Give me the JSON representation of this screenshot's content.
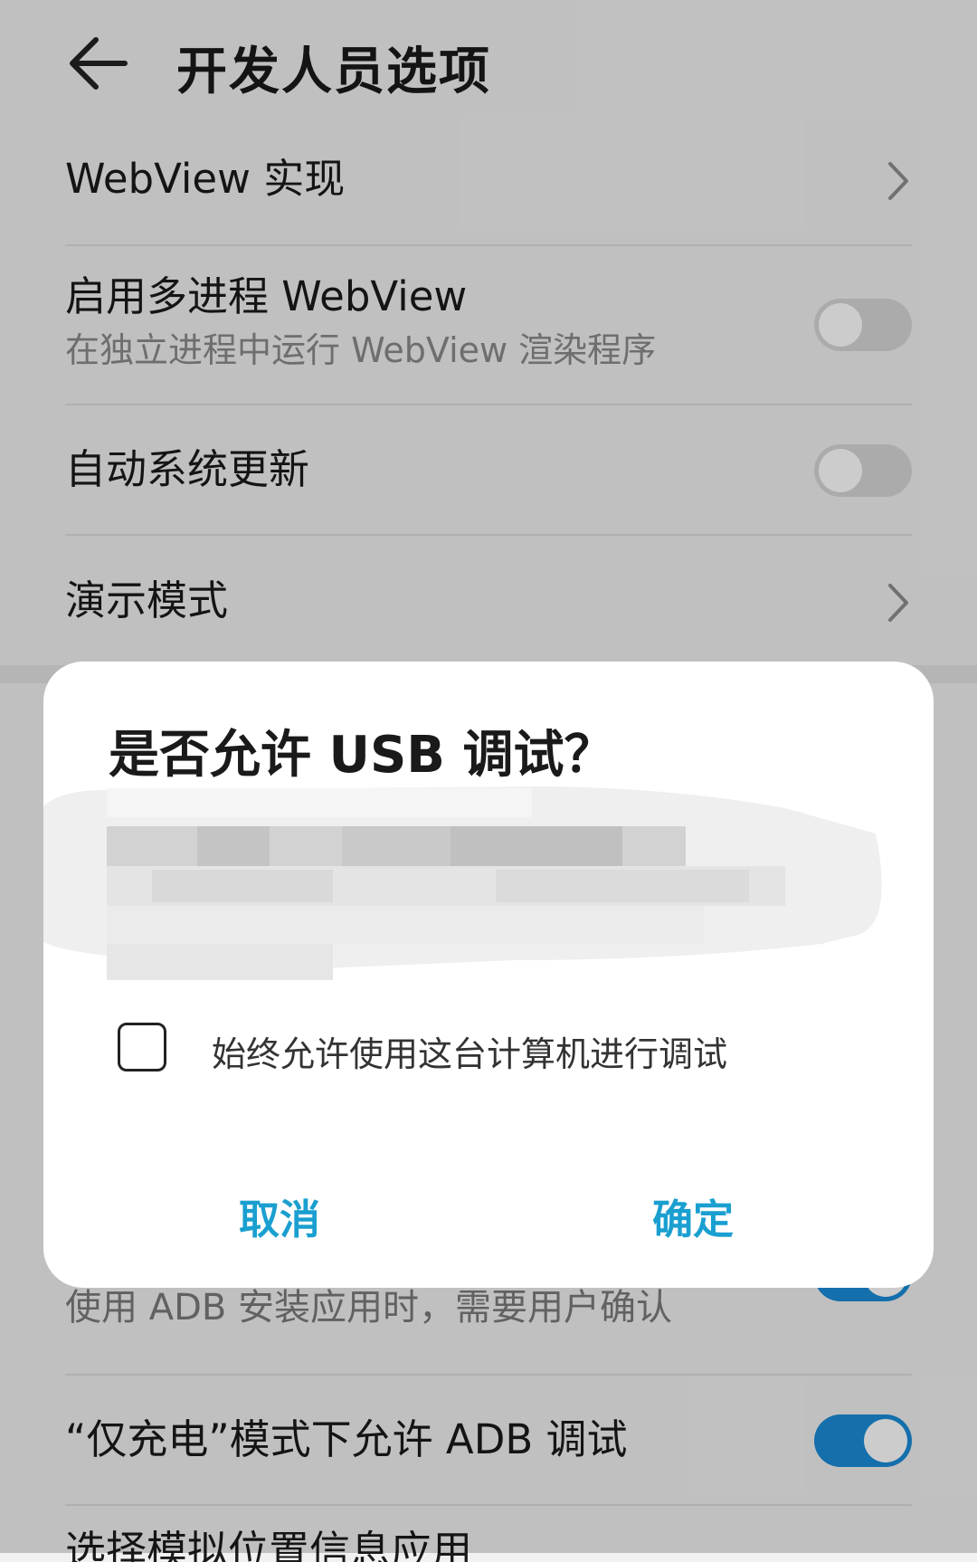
{
  "header": {
    "title": "开发人员选项"
  },
  "settings": [
    {
      "title": "WebView 实现"
    },
    {
      "title": "启用多进程 WebView",
      "subtitle": "在独立进程中运行 WebView 渲染程序",
      "toggle": false
    },
    {
      "title": "自动系统更新",
      "toggle": false
    },
    {
      "title": "演示模式"
    }
  ],
  "settings_lower": [
    {
      "subtitle": "使用 ADB 安装应用时，需要用户确认",
      "toggle": true
    },
    {
      "title": "“仅充电”模式下允许 ADB 调试",
      "toggle": true
    },
    {
      "title": "选择模拟位置信息应用"
    }
  ],
  "dialog": {
    "title": "是否允许 USB 调试？",
    "checkbox_label": "始终允许使用这台计算机进行调试",
    "checkbox_checked": false,
    "cancel_label": "取消",
    "ok_label": "确定"
  },
  "colors": {
    "accent": "#1a9fd0",
    "toggle_on": "#1a8bd8",
    "toggle_off": "#d6d6d6"
  }
}
